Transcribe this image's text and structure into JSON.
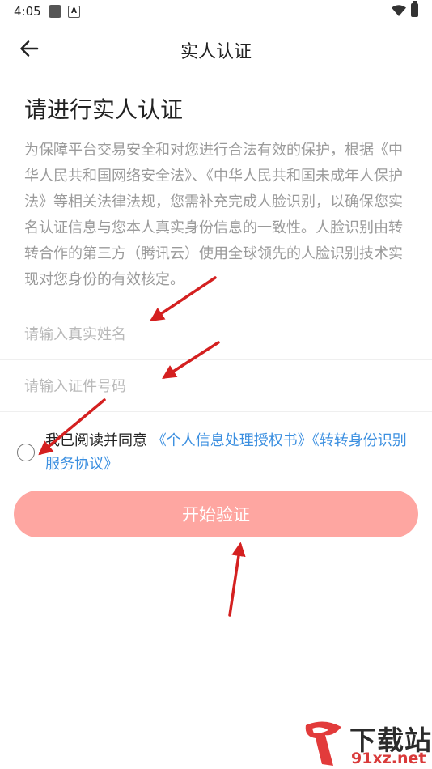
{
  "status_bar": {
    "time": "4:05",
    "icons": [
      "notification-square-icon",
      "a-icon",
      "wifi-icon",
      "battery-icon"
    ]
  },
  "nav": {
    "back_icon": "arrow-left-icon",
    "title": "实人认证"
  },
  "main": {
    "heading": "请进行实人认证",
    "description": "为保障平台交易安全和对您进行合法有效的保护，根据《中华人民共和国网络安全法》、《中华人民共和国未成年人保护法》等相关法律法规，您需补充完成人脸识别，以确保您实名认证信息与您本人真实身份信息的一致性。人脸识别由转转合作的第三方（腾讯云）使用全球领先的人脸识别技术实现对您身份的有效核定。",
    "name_input": {
      "value": "",
      "placeholder": "请输入真实姓名"
    },
    "id_input": {
      "value": "",
      "placeholder": "请输入证件号码"
    },
    "agreement": {
      "checked": false,
      "prefix": "我已阅读并同意",
      "link1": "《个人信息处理授权书》",
      "link2": "《转转身份识别服务协议》"
    },
    "start_button": "开始验证"
  },
  "watermark": {
    "title": "下载站",
    "url": "91xz.net"
  },
  "colors": {
    "button": "#fea6a1",
    "link": "#3b8fe0",
    "annotation_arrow": "#d42020"
  }
}
